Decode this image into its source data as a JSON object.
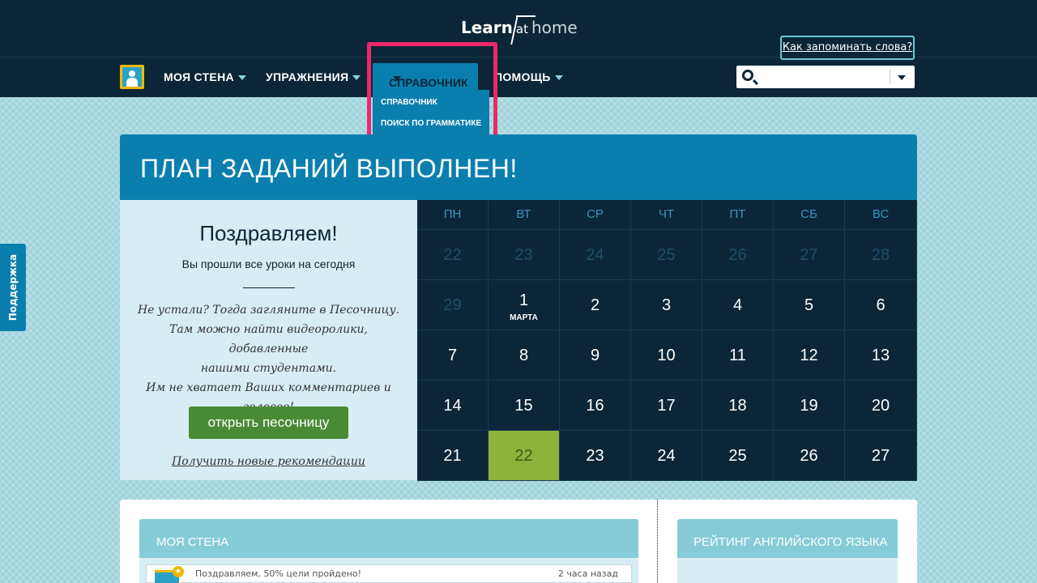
{
  "header": {
    "logo_learn": "Learn",
    "logo_at": "at",
    "logo_home": "home",
    "tip_link": "Как запоминать слова?"
  },
  "nav": {
    "items": [
      "МОЯ СТЕНА",
      "УПРАЖНЕНИЯ",
      "СПРАВОЧНИК",
      "ПОМОЩЬ"
    ],
    "active_index": 2,
    "dropdown": [
      "СПРАВОЧНИК",
      "ПОИСК ПО ГРАММАТИКЕ"
    ],
    "search_placeholder": ""
  },
  "support_tab": "Поддержка",
  "plan": {
    "title": "ПЛАН ЗАДАНИЙ ВЫПОЛНЕН!",
    "congrats": "Поздравляем!",
    "subtitle": "Вы прошли все уроки на сегодня",
    "italic_lines": [
      "Не устали? Тогда загляните в Песочницу.",
      "Там можно найти видеоролики, добавленные",
      "нашими студентами.",
      "Им не хватает Ваших комментариев и",
      "голосов!"
    ],
    "button": "открыть песочницу",
    "link": "Получить новые рекомендации"
  },
  "calendar": {
    "weekdays": [
      "ПН",
      "ВТ",
      "СР",
      "ЧТ",
      "ПТ",
      "СБ",
      "ВС"
    ],
    "weeks": [
      [
        {
          "d": "22",
          "muted": true
        },
        {
          "d": "23",
          "muted": true
        },
        {
          "d": "24",
          "muted": true
        },
        {
          "d": "25",
          "muted": true
        },
        {
          "d": "26",
          "muted": true
        },
        {
          "d": "27",
          "muted": true
        },
        {
          "d": "28",
          "muted": true
        }
      ],
      [
        {
          "d": "29",
          "muted": true
        },
        {
          "d": "1",
          "month": "МАРТА"
        },
        {
          "d": "2"
        },
        {
          "d": "3"
        },
        {
          "d": "4"
        },
        {
          "d": "5"
        },
        {
          "d": "6"
        }
      ],
      [
        {
          "d": "7"
        },
        {
          "d": "8"
        },
        {
          "d": "9"
        },
        {
          "d": "10"
        },
        {
          "d": "11"
        },
        {
          "d": "12"
        },
        {
          "d": "13"
        }
      ],
      [
        {
          "d": "14"
        },
        {
          "d": "15"
        },
        {
          "d": "16"
        },
        {
          "d": "17"
        },
        {
          "d": "18"
        },
        {
          "d": "19"
        },
        {
          "d": "20"
        }
      ],
      [
        {
          "d": "21"
        },
        {
          "d": "22",
          "today": true
        },
        {
          "d": "23"
        },
        {
          "d": "24"
        },
        {
          "d": "25"
        },
        {
          "d": "26"
        },
        {
          "d": "27"
        }
      ]
    ]
  },
  "wall": {
    "title": "МОЯ СТЕНА",
    "feed_text": "Поздравляем, 50% цели пройдено!",
    "feed_time": "2 часа назад"
  },
  "rating": {
    "title": "РЕЙТИНГ АНГЛИЙСКОГО ЯЗЫКА"
  },
  "colors": {
    "dark_navy": "#0b2638",
    "accent_blue": "#0a7fae",
    "highlight": "#f0276a",
    "today_green": "#8db33a",
    "button_green": "#4a8a34"
  }
}
